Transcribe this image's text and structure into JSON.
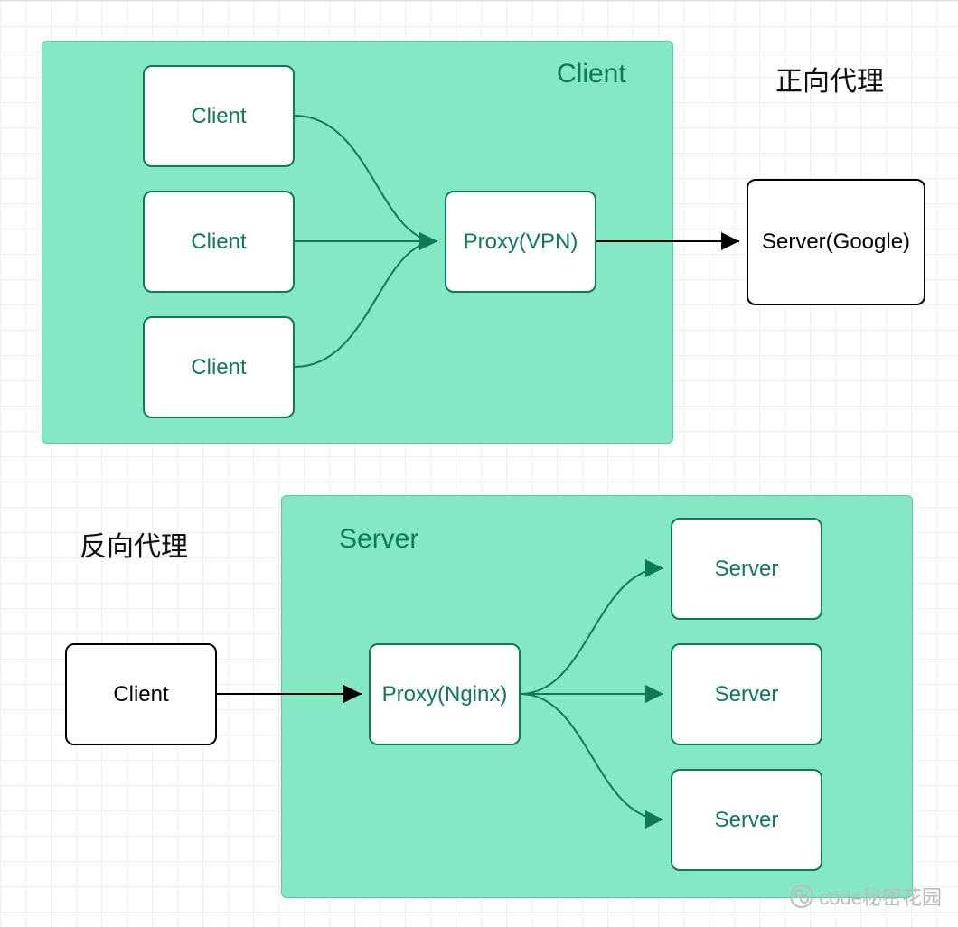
{
  "forward_proxy": {
    "title": "正向代理",
    "region_label": "Client",
    "clients": [
      "Client",
      "Client",
      "Client"
    ],
    "proxy": "Proxy(VPN)",
    "server": "Server(Google)"
  },
  "reverse_proxy": {
    "title": "反向代理",
    "region_label": "Server",
    "client": "Client",
    "proxy": "Proxy(Nginx)",
    "servers": [
      "Server",
      "Server",
      "Server"
    ]
  },
  "watermark": "code秘密花园",
  "colors": {
    "region_bg": "#84e8c4",
    "region_border": "#5fc9a4",
    "box_green": "#0d7a5a",
    "box_black": "#000000"
  }
}
